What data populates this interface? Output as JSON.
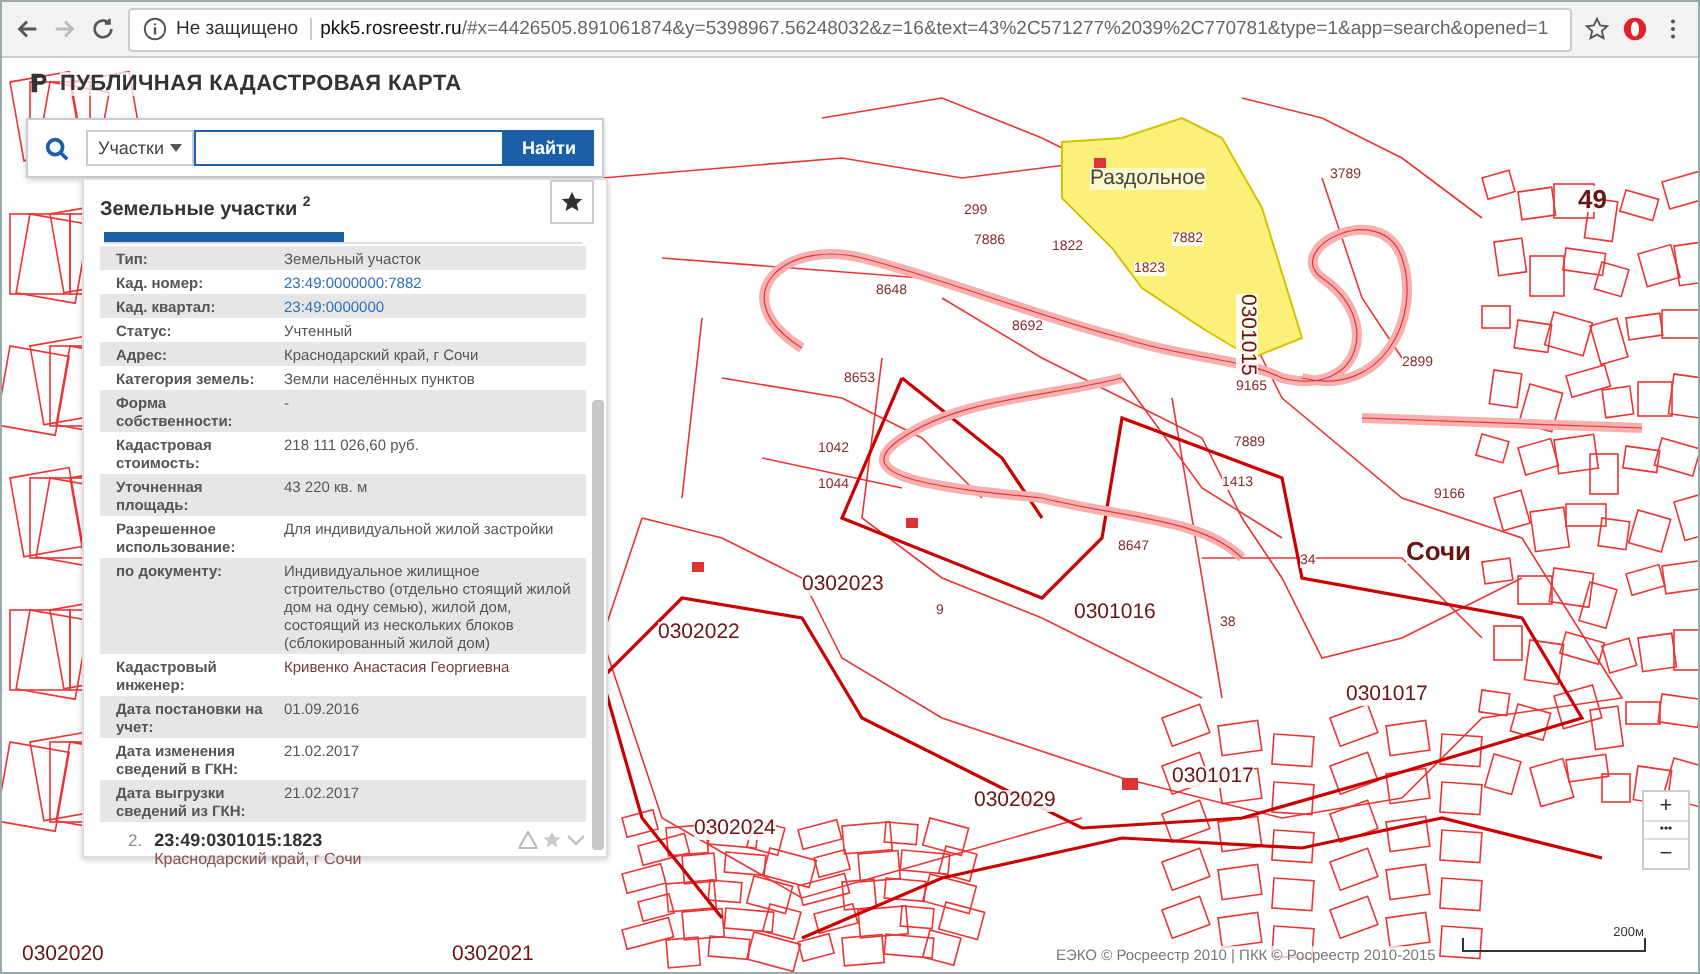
{
  "browser": {
    "security": "Не защищено",
    "url_host": "pkk5.rosreestr.ru",
    "url_rest": "/#x=4426505.891061874&y=5398967.56248032&z=16&text=43%2C571277%2039%2C770781&type=1&app=search&opened=1"
  },
  "app": {
    "title": "ПУБЛИЧНАЯ КАДАСТРОВАЯ КАРТА"
  },
  "search": {
    "category": "Участки",
    "button": "Найти"
  },
  "results": {
    "title": "Земельные участки $^{2}$",
    "tabs": [
      {
        "selected": true
      },
      {
        "selected": false
      }
    ],
    "details": [
      {
        "label": "Тип:",
        "value": "Земельный участок",
        "kind": "text"
      },
      {
        "label": "Кад. номер:",
        "value": "23:49:0000000:7882",
        "kind": "link"
      },
      {
        "label": "Кад. квартал:",
        "value": "23:49:0000000",
        "kind": "link"
      },
      {
        "label": "Статус:",
        "value": "Учтенный",
        "kind": "text"
      },
      {
        "label": "Адрес:",
        "value": "Краснодарский край, г Сочи",
        "kind": "text"
      },
      {
        "label": "Категория земель:",
        "value": "Земли населённых пунктов",
        "kind": "text"
      },
      {
        "label": "Форма собственности:",
        "value": "-",
        "kind": "text"
      },
      {
        "label": "Кадастровая стоимость:",
        "value": "218 111 026,60 руб.",
        "kind": "text"
      },
      {
        "label": "Уточненная площадь:",
        "value": "43 220 кв. м",
        "kind": "text"
      },
      {
        "label": "Разрешенное использование:",
        "value": "Для индивидуальной жилой застройки",
        "kind": "text"
      },
      {
        "label": "по документу:",
        "value": "Индивидуальное жилищное строительство (отдельно стоящий жилой дом на одну семью), жилой дом, состоящий из нескольких блоков (сблокированный жилой дом)",
        "kind": "text"
      },
      {
        "label": "Кадастровый инженер:",
        "value": "Кривенко Анастасия Георгиевна",
        "kind": "accent"
      },
      {
        "label": "Дата постановки на учет:",
        "value": "01.09.2016",
        "kind": "text"
      },
      {
        "label": "Дата изменения сведений в ГКН:",
        "value": "21.02.2017",
        "kind": "text"
      },
      {
        "label": "Дата выгрузки сведений из ГКН:",
        "value": "21.02.2017",
        "kind": "text"
      }
    ],
    "items": [
      {
        "index": "2.",
        "number": "23:49:0301015:1823",
        "address": "Краснодарский край, г Сочи"
      }
    ]
  },
  "map": {
    "labels": [
      {
        "text": "Раздольное",
        "kind": "place"
      },
      {
        "text": "Сочи",
        "kind": "city"
      },
      {
        "text": "49",
        "kind": "city"
      },
      {
        "text": "0301015",
        "kind": "quarter"
      },
      {
        "text": "0301016",
        "kind": "quarter"
      },
      {
        "text": "0302023",
        "kind": "quarter"
      },
      {
        "text": "0302022",
        "kind": "quarter"
      },
      {
        "text": "0301017",
        "kind": "quarter"
      },
      {
        "text": "0301017",
        "kind": "quarter"
      },
      {
        "text": "0302024",
        "kind": "quarter"
      },
      {
        "text": "0302029",
        "kind": "quarter"
      },
      {
        "text": "0302020",
        "kind": "quarter"
      },
      {
        "text": "0302021",
        "kind": "quarter"
      },
      {
        "text": "8648",
        "kind": "parcel"
      },
      {
        "text": "8692",
        "kind": "parcel"
      },
      {
        "text": "8653",
        "kind": "parcel"
      },
      {
        "text": "9166",
        "kind": "parcel"
      },
      {
        "text": "8647",
        "kind": "parcel"
      },
      {
        "text": "3789",
        "kind": "parcel"
      },
      {
        "text": "2899",
        "kind": "parcel"
      },
      {
        "text": "7886",
        "kind": "parcel"
      },
      {
        "text": "1822",
        "kind": "parcel"
      },
      {
        "text": "1823",
        "kind": "parcel"
      },
      {
        "text": "7882",
        "kind": "parcel"
      },
      {
        "text": "299",
        "kind": "parcel"
      },
      {
        "text": "9165",
        "kind": "parcel"
      },
      {
        "text": "7889",
        "kind": "parcel"
      },
      {
        "text": "1413",
        "kind": "parcel"
      },
      {
        "text": "1042",
        "kind": "parcel"
      },
      {
        "text": "1044",
        "kind": "parcel"
      },
      {
        "text": "34",
        "kind": "parcel"
      },
      {
        "text": "38",
        "kind": "parcel"
      },
      {
        "text": "9",
        "kind": "parcel"
      }
    ],
    "zoom": {
      "plus": "+",
      "more": "•••",
      "minus": "−"
    },
    "attribution": "ЕЭКО © Росреестр 2010 | ПКК © Росреестр 2010-2015",
    "scale": "200м"
  }
}
